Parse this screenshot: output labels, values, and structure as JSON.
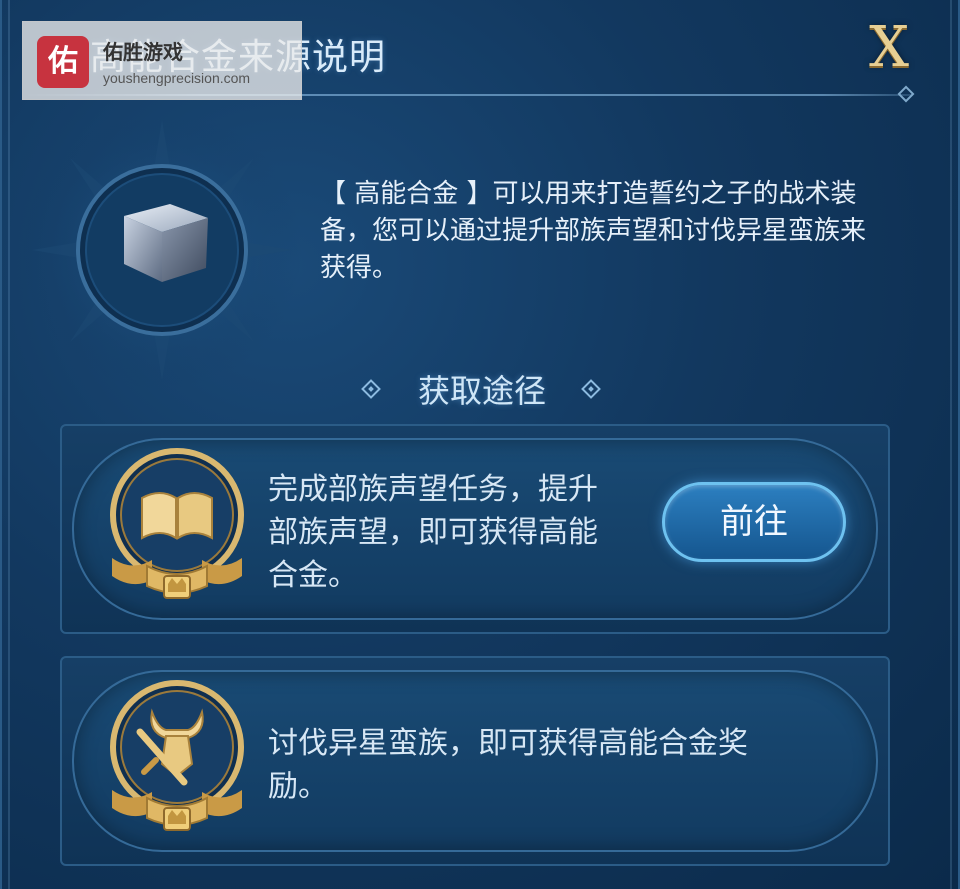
{
  "header": {
    "title": "高能合金来源说明",
    "close_label": "X"
  },
  "watermark": {
    "logo_char": "佑",
    "name": "佑胜游戏",
    "url": "youshengprecision.com"
  },
  "item": {
    "description": "【 高能合金 】可以用来打造誓约之子的战术装备，您可以通过提升部族声望和讨伐异星蛮族来获得。"
  },
  "section": {
    "title": "获取途径"
  },
  "routes": [
    {
      "icon": "book-icon",
      "text_line1": "完成部族声望任务，提升",
      "text_line2": "部族声望，即可获得高能",
      "text_line3": "合金。",
      "button_label": "前往"
    },
    {
      "icon": "horned-helmet-sword-icon",
      "text_line1": "讨伐异星蛮族，即可获得高能合金奖",
      "text_line2": "励。"
    }
  ],
  "colors": {
    "gold": "#e7cf93",
    "panel_blue": "#12385f",
    "button_blue": "#2c7fc0"
  }
}
